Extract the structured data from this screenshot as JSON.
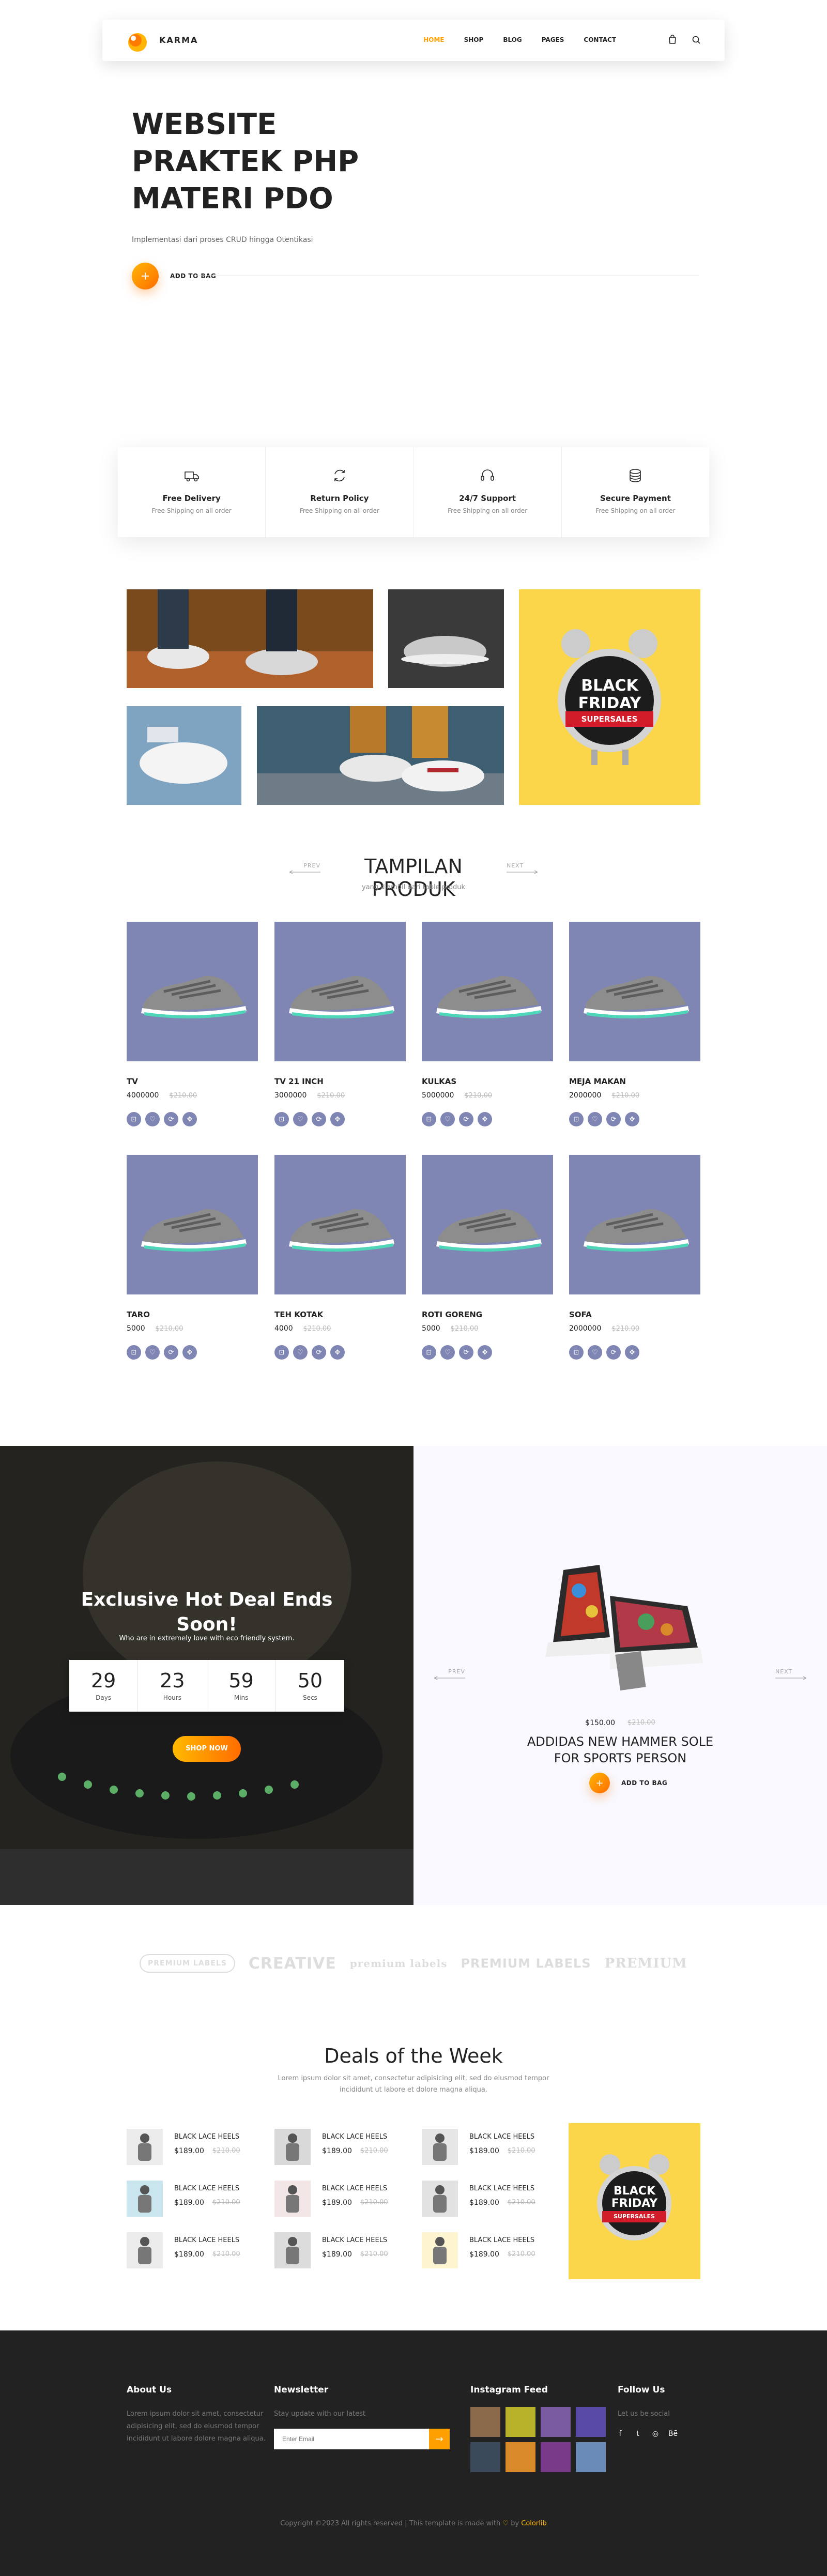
{
  "header": {
    "brand": "KARMA",
    "nav": [
      "HOME",
      "SHOP",
      "BLOG",
      "PAGES",
      "CONTACT"
    ],
    "active_nav": "HOME",
    "icons": [
      "shopping-bag-icon",
      "search-icon"
    ]
  },
  "hero": {
    "title_lines": [
      "WEBSITE",
      "PRAKTEK PHP",
      "MATERI PDO"
    ],
    "subtitle": "Implementasi dari proses CRUD hingga Otentikasi",
    "button_label": "ADD TO BAG"
  },
  "features": [
    {
      "icon": "delivery-truck-icon",
      "title": "Free Delivery",
      "sub": "Free Shipping on all order"
    },
    {
      "icon": "return-policy-icon",
      "title": "Return Policy",
      "sub": "Free Shipping on all order"
    },
    {
      "icon": "headset-support-icon",
      "title": "24/7 Support",
      "sub": "Free Shipping on all order"
    },
    {
      "icon": "secure-payment-icon",
      "title": "Secure Payment",
      "sub": "Free Shipping on all order"
    }
  ],
  "promo": {
    "line1": "BLACK",
    "line2": "FRIDAY",
    "banner": "SUPERSALES"
  },
  "products_section": {
    "title": "TAMPILAN PRODUK",
    "subtitle": "yang diambil dari table produk",
    "prev": "PREV",
    "next": "NEXT"
  },
  "products": [
    {
      "name": "TV",
      "price": "4000000",
      "old_price": "$210.00"
    },
    {
      "name": "TV 21 INCH",
      "price": "3000000",
      "old_price": "$210.00"
    },
    {
      "name": "KULKAS",
      "price": "5000000",
      "old_price": "$210.00"
    },
    {
      "name": "MEJA MAKAN",
      "price": "2000000",
      "old_price": "$210.00"
    },
    {
      "name": "TARO",
      "price": "5000",
      "old_price": "$210.00"
    },
    {
      "name": "TEH KOTAK",
      "price": "4000",
      "old_price": "$210.00"
    },
    {
      "name": "ROTI GORENG",
      "price": "5000",
      "old_price": "$210.00"
    },
    {
      "name": "SOFA",
      "price": "2000000",
      "old_price": "$210.00"
    }
  ],
  "product_icons": [
    "bag-icon",
    "heart-icon",
    "sync-icon",
    "move-icon"
  ],
  "deal": {
    "title_lines": [
      "Exclusive Hot Deal Ends",
      "Soon!"
    ],
    "subtitle": "Who are in extremely love with eco friendly system.",
    "countdown": [
      {
        "num": "29",
        "label": "Days"
      },
      {
        "num": "23",
        "label": "Hours"
      },
      {
        "num": "59",
        "label": "Mins"
      },
      {
        "num": "50",
        "label": "Secs"
      }
    ],
    "button": "SHOP NOW"
  },
  "featured": {
    "prev": "PREV",
    "next": "NEXT",
    "price": "$150.00",
    "old_price": "$210.00",
    "name_lines": [
      "ADDIDAS NEW HAMMER SOLE",
      "FOR SPORTS PERSON"
    ],
    "button_label": "ADD TO BAG"
  },
  "brands": [
    "PREMIUM LABELS",
    "CREATIVE",
    "premium labels",
    "PREMIUM LABELS",
    "PREMIUM"
  ],
  "deals_week": {
    "title": "Deals of the Week",
    "sub_lines": [
      "Lorem ipsum dolor sit amet, consectetur adipisicing elit, sed do eiusmod tempor",
      "incididunt ut labore et dolore magna aliqua."
    ],
    "items": [
      {
        "name": "BLACK LACE HEELS",
        "price": "$189.00",
        "old_price": "$210.00"
      },
      {
        "name": "BLACK LACE HEELS",
        "price": "$189.00",
        "old_price": "$210.00"
      },
      {
        "name": "BLACK LACE HEELS",
        "price": "$189.00",
        "old_price": "$210.00"
      },
      {
        "name": "BLACK LACE HEELS",
        "price": "$189.00",
        "old_price": "$210.00"
      },
      {
        "name": "BLACK LACE HEELS",
        "price": "$189.00",
        "old_price": "$210.00"
      },
      {
        "name": "BLACK LACE HEELS",
        "price": "$189.00",
        "old_price": "$210.00"
      },
      {
        "name": "BLACK LACE HEELS",
        "price": "$189.00",
        "old_price": "$210.00"
      },
      {
        "name": "BLACK LACE HEELS",
        "price": "$189.00",
        "old_price": "$210.00"
      },
      {
        "name": "BLACK LACE HEELS",
        "price": "$189.00",
        "old_price": "$210.00"
      }
    ]
  },
  "footer": {
    "about_title": "About Us",
    "about_lines": [
      "Lorem ipsum dolor sit amet, consectetur",
      "adipisicing elit, sed do eiusmod tempor",
      "incididunt ut labore dolore magna aliqua."
    ],
    "newsletter_title": "Newsletter",
    "newsletter_text": "Stay update with our latest",
    "email_placeholder": "Enter Email",
    "instagram_title": "Instagram Feed",
    "follow_title": "Follow Us",
    "follow_text": "Let us be social",
    "social": [
      "f",
      "t",
      "◎",
      "Bē"
    ],
    "copyright_pre": "Copyright ©2023 All rights reserved | This template is made with",
    "copyright_by": "by",
    "copyright_brand": "Colorlib"
  },
  "colors": {
    "accent": "#ff9f00",
    "product_bg": "#7f86b3",
    "footer_bg": "#222222"
  }
}
